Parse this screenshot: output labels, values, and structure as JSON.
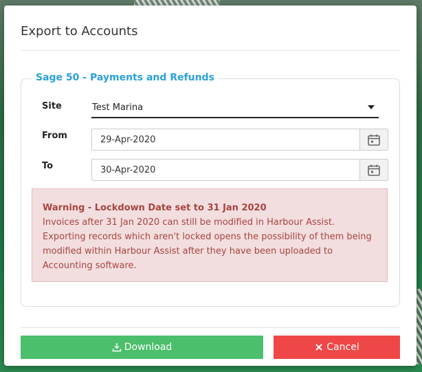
{
  "dialog": {
    "title": "Export to Accounts",
    "section_title": "Sage 50 - Payments and Refunds"
  },
  "form": {
    "site_label": "Site",
    "site_value": "Test Marina",
    "from_label": "From",
    "from_value": "29-Apr-2020",
    "to_label": "To",
    "to_value": "30-Apr-2020"
  },
  "warning": {
    "title": "Warning - Lockdown Date set to 31 Jan 2020",
    "line1": "Invoices after 31 Jan 2020 can still be modified in Harbour Assist.",
    "line2": "Exporting records which aren't locked opens the possibility of them being modified within Harbour Assist after they have been uploaded to Accounting software."
  },
  "buttons": {
    "download_label": "Download",
    "cancel_label": "Cancel"
  },
  "icons": {
    "calendar": "calendar-icon",
    "download": "download-icon",
    "close": "close-icon",
    "dropdown": "chevron-down-icon"
  },
  "colors": {
    "accent": "#2ba0d8",
    "download": "#4bbf6b",
    "cancel": "#ef4747",
    "warning_bg": "#f2dede",
    "warning_text": "#a94442"
  }
}
